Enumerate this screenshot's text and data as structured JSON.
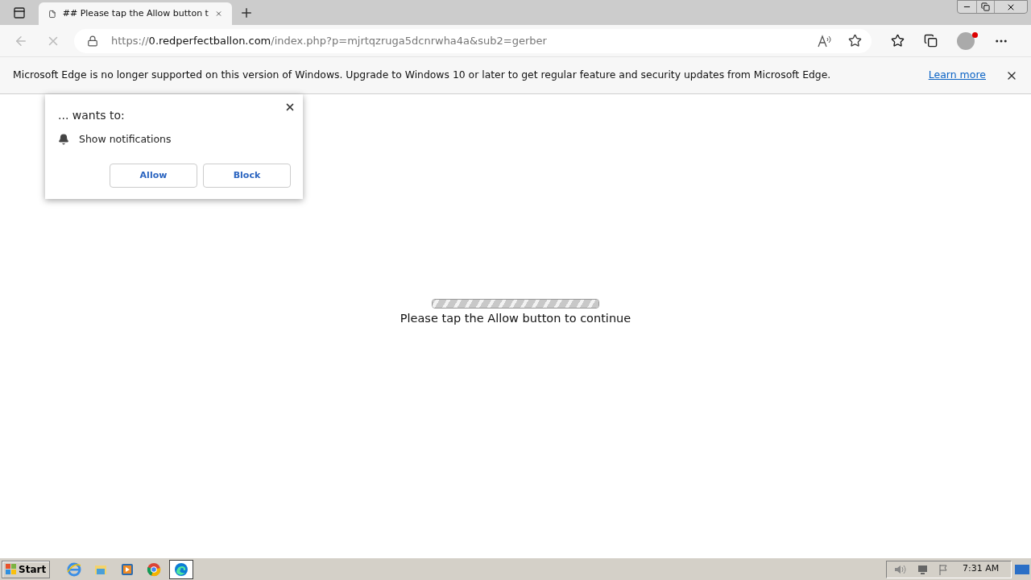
{
  "tab": {
    "title": "## Please tap the Allow button t"
  },
  "address_bar": {
    "scheme": "https://",
    "host": "0.redperfectballon.com",
    "path": "/index.php?p=mjrtqzruga5dcnrwha4a&sub2=gerber"
  },
  "info_bar": {
    "message": "Microsoft Edge is no longer supported on this version of Windows. Upgrade to Windows 10 or later to get regular feature and security updates from Microsoft Edge.",
    "link": "Learn more"
  },
  "permission_popup": {
    "title": "... wants to:",
    "permission": "Show notifications",
    "buttons": [
      "Allow",
      "Block"
    ]
  },
  "page": {
    "message": "Please tap the Allow button to continue",
    "progress": {
      "level": 1
    }
  },
  "taskbar": {
    "start": "Start",
    "apps": [
      {
        "kind": "ie",
        "selected": false
      },
      {
        "kind": "explorer",
        "selected": false
      },
      {
        "kind": "media",
        "selected": false
      },
      {
        "kind": "chrome",
        "selected": false
      },
      {
        "kind": "edge",
        "selected": true
      }
    ],
    "clock": "7:31 AM"
  }
}
